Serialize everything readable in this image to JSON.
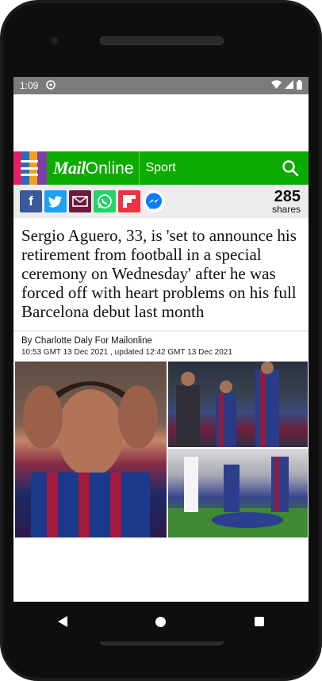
{
  "status": {
    "time": "1:09"
  },
  "header": {
    "logo_mail": "Mail",
    "logo_online": "Online",
    "section": "Sport"
  },
  "share": {
    "count": "285",
    "label": "shares",
    "buttons": [
      "facebook-icon",
      "twitter-icon",
      "email-icon",
      "whatsapp-icon",
      "flipboard-icon",
      "messenger-icon"
    ]
  },
  "article": {
    "headline": "Sergio Aguero, 33, is 'set to announce his retirement from football in a special ceremony on Wednesday' after he was forced off with heart problems on his full Barcelona debut last month",
    "byline": "By Charlotte Daly For Mailonline",
    "date": "10:53 GMT 13 Dec 2021 , updated 12:42 GMT 13 Dec 2021"
  },
  "colors": {
    "brand_green": "#0cab00",
    "sharebar_bg": "#ececec"
  }
}
